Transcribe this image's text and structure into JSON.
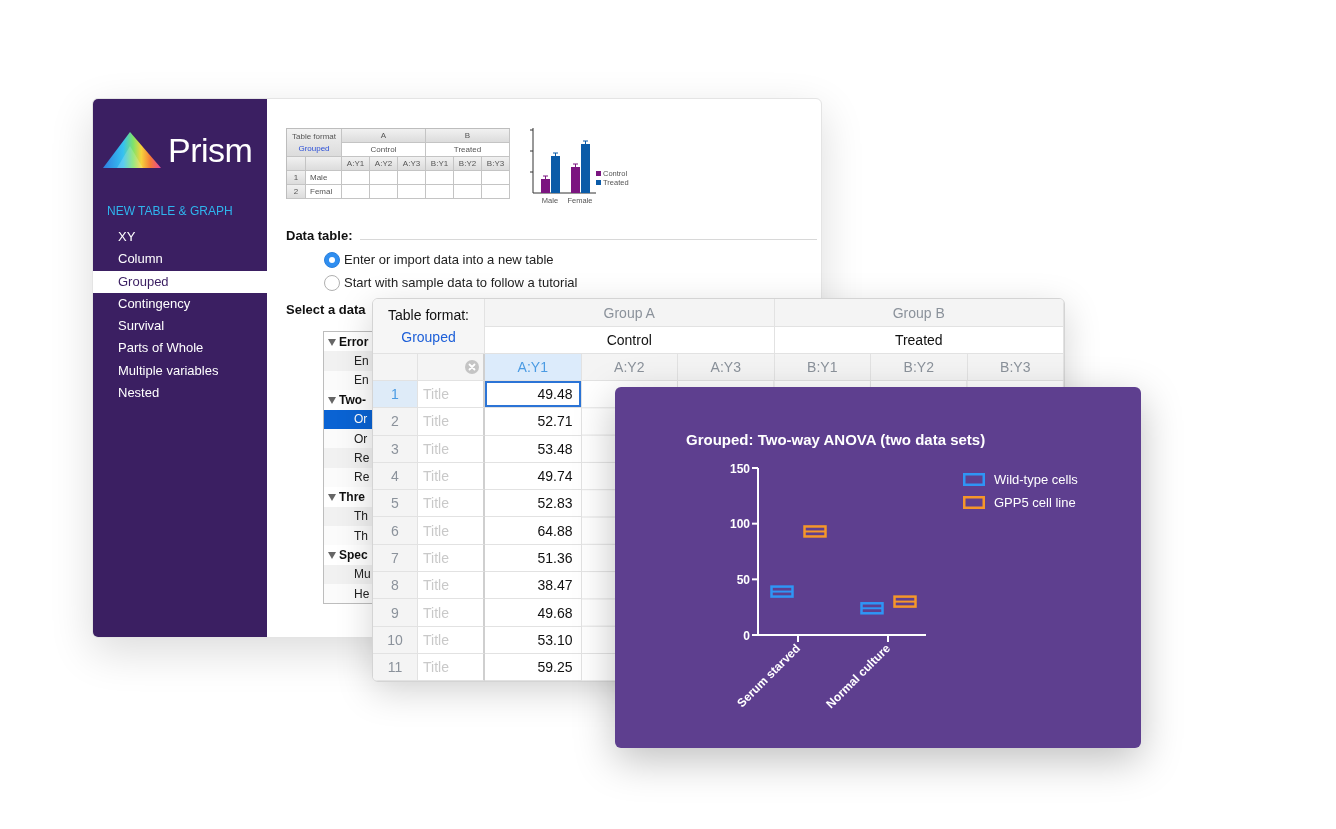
{
  "dialog": {
    "logo": "Prism",
    "sidebar": {
      "heading": "NEW TABLE & GRAPH",
      "items": [
        {
          "label": "XY",
          "selected": false
        },
        {
          "label": "Column",
          "selected": false
        },
        {
          "label": "Grouped",
          "selected": true
        },
        {
          "label": "Contingency",
          "selected": false
        },
        {
          "label": "Survival",
          "selected": false
        },
        {
          "label": "Parts of Whole",
          "selected": false
        },
        {
          "label": "Multiple variables",
          "selected": false
        },
        {
          "label": "Nested",
          "selected": false
        }
      ]
    },
    "preview_table": {
      "format_label": "Table format",
      "format_value": "Grouped",
      "groups": [
        "A",
        "B"
      ],
      "datasets": [
        "Control",
        "Treated"
      ],
      "columns": [
        "A:Y1",
        "A:Y2",
        "A:Y3",
        "B:Y1",
        "B:Y2",
        "B:Y3"
      ],
      "rows": [
        {
          "number": "1",
          "title": "Male"
        },
        {
          "number": "2",
          "title": "Femal"
        }
      ]
    },
    "preview_graph": {
      "categories": [
        "Male",
        "Female"
      ],
      "series": [
        {
          "name": "Control",
          "color": "#7b1580"
        },
        {
          "name": "Treated",
          "color": "#0b5ba8"
        }
      ]
    },
    "data_table": {
      "heading": "Data table:",
      "options": [
        {
          "label": "Enter or import data into a new table",
          "selected": true
        },
        {
          "label": "Start with sample data to follow a tutorial",
          "selected": false
        }
      ]
    },
    "select_heading": "Select a data",
    "templates": [
      {
        "label": "Error",
        "expanded": true,
        "children": [
          {
            "label": "En",
            "selected": false
          },
          {
            "label": "En",
            "selected": false
          }
        ]
      },
      {
        "label": "Two-",
        "expanded": true,
        "children": [
          {
            "label": "Or",
            "selected": true
          },
          {
            "label": "Or",
            "selected": false
          },
          {
            "label": "Re",
            "selected": false
          },
          {
            "label": "Re",
            "selected": false
          }
        ]
      },
      {
        "label": "Thre",
        "expanded": true,
        "children": [
          {
            "label": "Th",
            "selected": false
          },
          {
            "label": "Th",
            "selected": false
          }
        ]
      },
      {
        "label": "Spec",
        "expanded": true,
        "children": [
          {
            "label": "Mu",
            "selected": false
          },
          {
            "label": "He",
            "selected": false
          }
        ]
      }
    ]
  },
  "data_window": {
    "format_label": "Table format:",
    "format_value": "Grouped",
    "groups": [
      "Group A",
      "Group B"
    ],
    "datasets": [
      "Control",
      "Treated"
    ],
    "columns": [
      {
        "label": "A:Y1",
        "selected": true
      },
      {
        "label": "A:Y2",
        "selected": false
      },
      {
        "label": "A:Y3",
        "selected": false
      },
      {
        "label": "B:Y1",
        "selected": false
      },
      {
        "label": "B:Y2",
        "selected": false
      },
      {
        "label": "B:Y3",
        "selected": false
      }
    ],
    "rows": [
      {
        "number": "1",
        "placeholder": "Title",
        "value": "49.48",
        "selected": true
      },
      {
        "number": "2",
        "placeholder": "Title",
        "value": "52.71",
        "selected": false
      },
      {
        "number": "3",
        "placeholder": "Title",
        "value": "53.48",
        "selected": false
      },
      {
        "number": "4",
        "placeholder": "Title",
        "value": "49.74",
        "selected": false
      },
      {
        "number": "5",
        "placeholder": "Title",
        "value": "52.83",
        "selected": false
      },
      {
        "number": "6",
        "placeholder": "Title",
        "value": "64.88",
        "selected": false
      },
      {
        "number": "7",
        "placeholder": "Title",
        "value": "51.36",
        "selected": false
      },
      {
        "number": "8",
        "placeholder": "Title",
        "value": "38.47",
        "selected": false
      },
      {
        "number": "9",
        "placeholder": "Title",
        "value": "49.68",
        "selected": false
      },
      {
        "number": "10",
        "placeholder": "Title",
        "value": "53.10",
        "selected": false
      },
      {
        "number": "11",
        "placeholder": "Title",
        "value": "59.25",
        "selected": false
      }
    ]
  },
  "graph_window": {
    "chart_data": {
      "type": "scatter",
      "title": "Grouped: Two-way ANOVA (two data sets)",
      "categories": [
        "Serum starved",
        "Normal culture"
      ],
      "series": [
        {
          "name": "Wild-type cells",
          "color": "#2f95f5",
          "values": [
            39,
            24
          ]
        },
        {
          "name": "GPP5 cell line",
          "color": "#f5962a",
          "values": [
            93,
            30
          ]
        }
      ],
      "ylim": [
        0,
        150
      ],
      "yticks": [
        0,
        50,
        100,
        150
      ],
      "legend": "right"
    }
  }
}
